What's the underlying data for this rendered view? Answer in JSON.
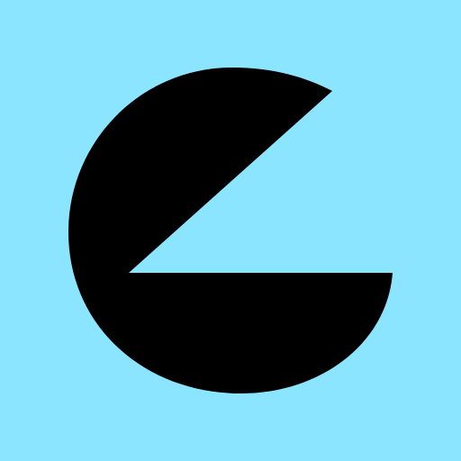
{
  "colors": {
    "background": "#8be5ff",
    "logo_fill": "#000000"
  },
  "icon": {
    "name": "c-shaped-pacman-logo-icon"
  }
}
